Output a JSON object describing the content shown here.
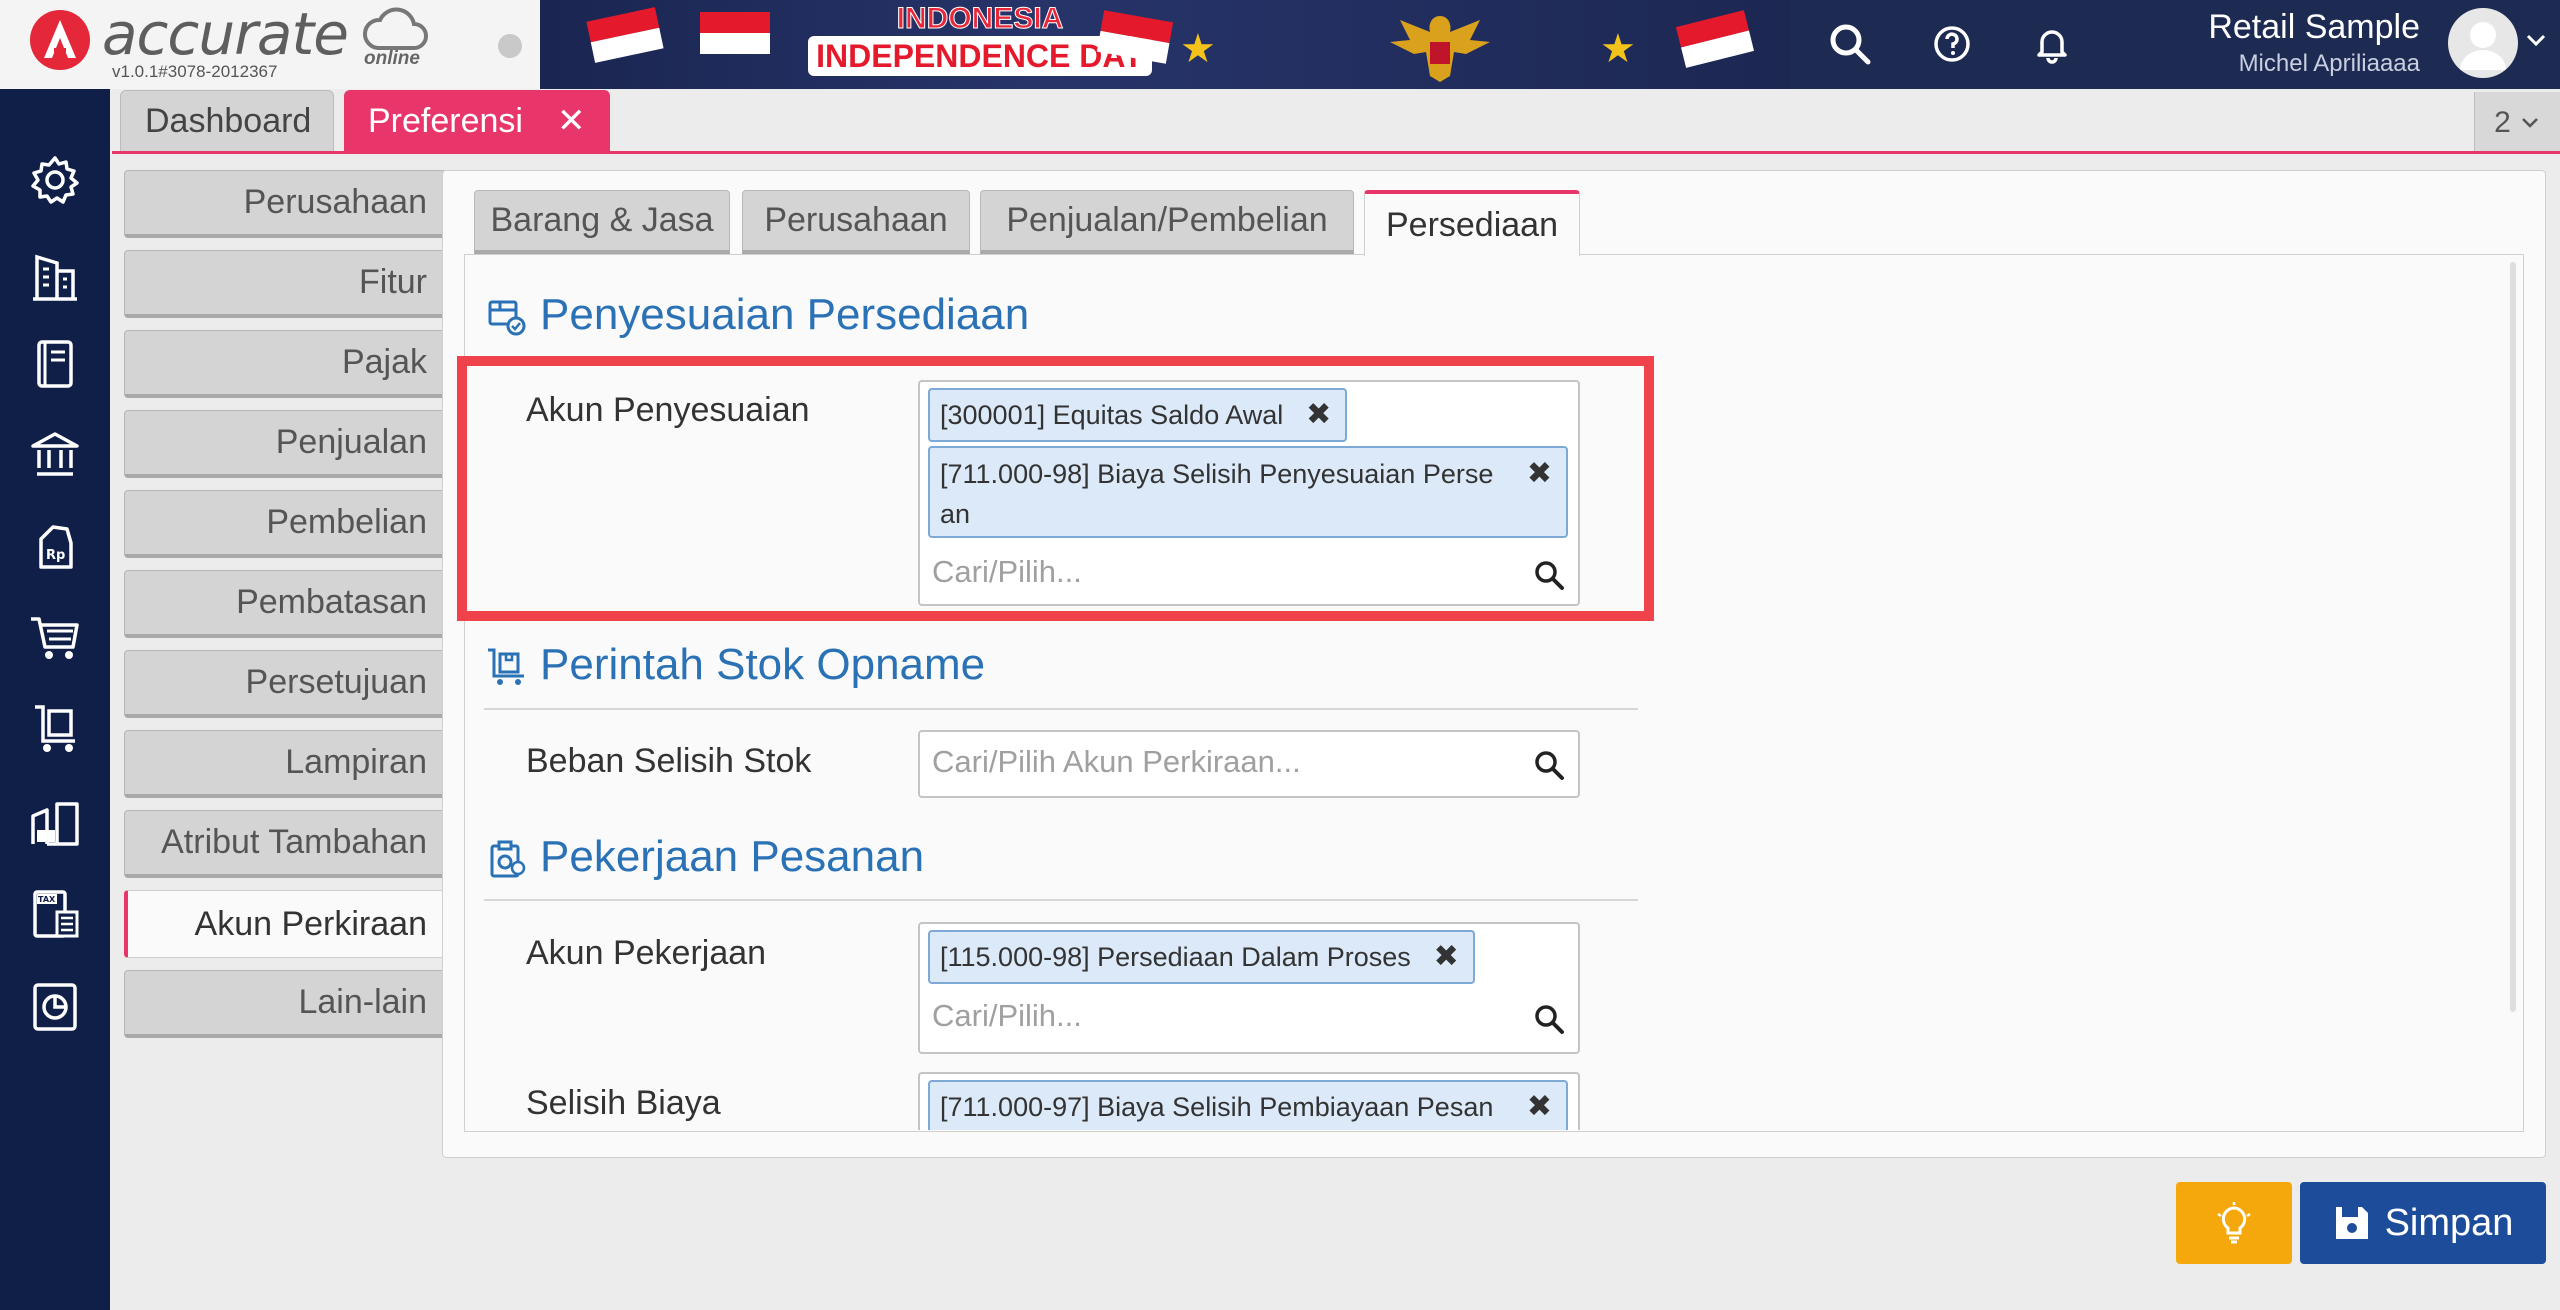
{
  "header": {
    "brand": "accurate",
    "brand_suffix": "online",
    "version": "v1.0.1#3078-2012367",
    "banner_line1": "INDONESIA",
    "banner_line2": "INDEPENDENCE DAY",
    "company": "Retail Sample",
    "user": "Michel Apriliaaaa",
    "icons": [
      "search-icon",
      "help-icon",
      "bell-icon",
      "avatar"
    ]
  },
  "sidebar_icons": [
    "gear-icon",
    "building-icon",
    "book-icon",
    "bank-icon",
    "price-tag-icon",
    "cart-icon",
    "trolley-icon",
    "warehouse-icon",
    "tax-icon",
    "report-icon"
  ],
  "page_tabs": [
    {
      "label": "Dashboard"
    },
    {
      "label": "Preferensi",
      "close": "✕"
    }
  ],
  "tab_count": "2",
  "nav": [
    "Perusahaan",
    "Fitur",
    "Pajak",
    "Penjualan",
    "Pembelian",
    "Pembatasan",
    "Persetujuan",
    "Lampiran",
    "Atribut Tambahan",
    "Akun Perkiraan",
    "Lain-lain"
  ],
  "nav_active": "Akun Perkiraan",
  "subtabs": [
    "Barang & Jasa",
    "Perusahaan",
    "Penjualan/Pembelian",
    "Persediaan"
  ],
  "subtab_active": "Persediaan",
  "sections": {
    "penyesuaian": {
      "title": "Penyesuaian Persediaan",
      "label": "Akun Penyesuaian",
      "chips": [
        "[300001] Equitas Saldo Awal",
        "[711.000-98] Biaya Selisih Penyesuaian Perse",
        "an"
      ],
      "placeholder": "Cari/Pilih..."
    },
    "opname": {
      "title": "Perintah Stok Opname",
      "label": "Beban Selisih Stok",
      "placeholder": "Cari/Pilih Akun Perkiraan..."
    },
    "pesanan": {
      "title": "Pekerjaan Pesanan",
      "label1": "Akun Pekerjaan",
      "chip1": "[115.000-98] Persediaan Dalam Proses",
      "placeholder": "Cari/Pilih...",
      "label2": "Selisih Biaya",
      "chip2": "[711.000-97] Biaya Selisih Pembiayaan Pesan"
    }
  },
  "chip_close": "✖",
  "buttons": {
    "idea": "lightbulb-icon",
    "save": "Simpan"
  },
  "colors": {
    "accent": "#e8366a",
    "navy": "#0f1f47",
    "link": "#2a72b5",
    "save": "#1c4c9a",
    "idea": "#f5a80c",
    "highlight": "#f0424a"
  }
}
